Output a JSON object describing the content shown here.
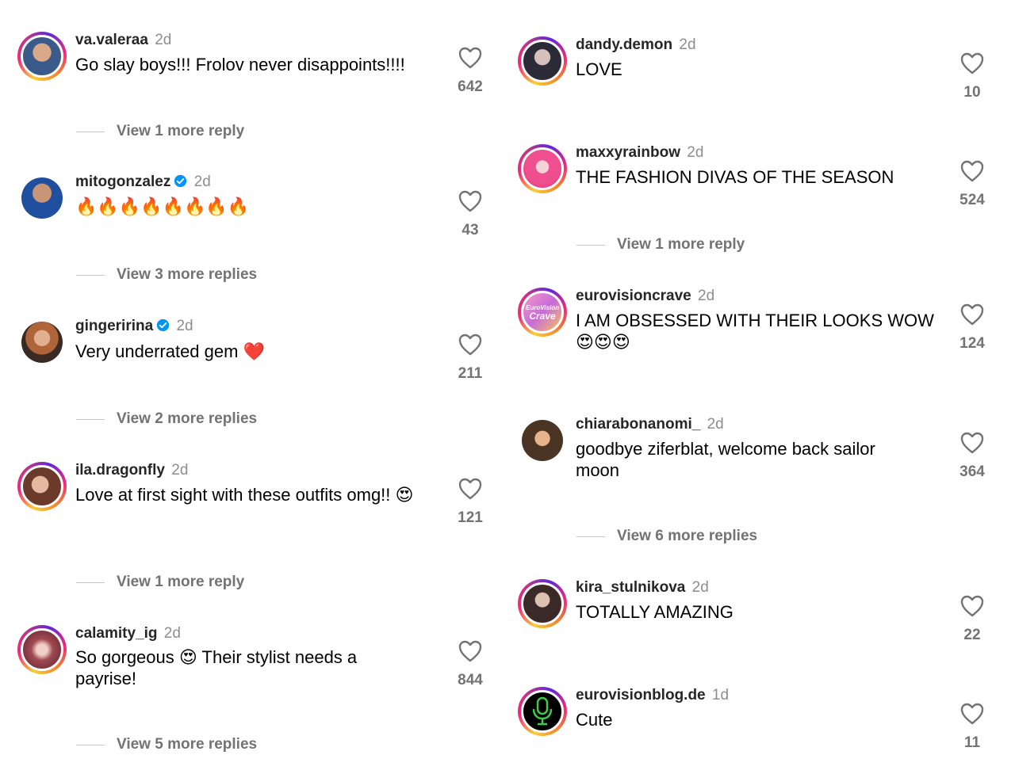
{
  "colors": {
    "username": "#262626",
    "timestamp": "#8e8e8e",
    "muted": "#737373",
    "verified": "#0095f6"
  },
  "left_column": [
    {
      "username": "va.valeraa",
      "time": "2d",
      "verified": false,
      "text": "Go slay boys!!! Frolov never disappoints!!!!",
      "likes": "642",
      "more_replies": "View 1 more reply"
    },
    {
      "username": "mitogonzalez",
      "time": "2d",
      "verified": true,
      "text": "🔥🔥🔥🔥🔥🔥🔥🔥",
      "likes": "43",
      "more_replies": "View 3 more replies"
    },
    {
      "username": "gingeririna",
      "time": "2d",
      "verified": true,
      "text": "Very underrated gem ❤️",
      "likes": "211",
      "more_replies": "View 2 more replies"
    },
    {
      "username": "ila.dragonfly",
      "time": "2d",
      "verified": false,
      "text": "Love at first sight with these outfits omg!! 😍",
      "likes": "121",
      "more_replies": "View 1 more reply"
    },
    {
      "username": "calamity_ig",
      "time": "2d",
      "verified": false,
      "text": "So gorgeous 😍 Their stylist needs a payrise!",
      "likes": "844",
      "more_replies": "View 5 more replies"
    }
  ],
  "right_column": [
    {
      "username": "dandy.demon",
      "time": "2d",
      "text": "LOVE",
      "likes": "10"
    },
    {
      "username": "maxxyrainbow",
      "time": "2d",
      "text": "THE FASHION DIVAS OF THE SEASON",
      "likes": "524",
      "more_replies": "View 1 more reply"
    },
    {
      "username": "eurovisioncrave",
      "time": "2d",
      "text": "I AM OBSESSED WITH THEIR LOOKS WOW 😍😍😍",
      "likes": "124",
      "avatar_text": [
        "EuroVision",
        "Crave"
      ]
    },
    {
      "username": "chiarabonanomi_",
      "time": "2d",
      "text": "goodbye ziferblat, welcome back sailor moon",
      "likes": "364",
      "more_replies": "View 6 more replies"
    },
    {
      "username": "kira_stulnikova",
      "time": "2d",
      "text": "TOTALLY AMAZING",
      "likes": "22"
    },
    {
      "username": "eurovisionblog.de",
      "time": "1d",
      "text": "Cute",
      "likes": "11"
    }
  ],
  "icons": {
    "like": "heart-outline-icon",
    "verified": "verified-badge-icon",
    "microphone": "microphone-icon"
  }
}
